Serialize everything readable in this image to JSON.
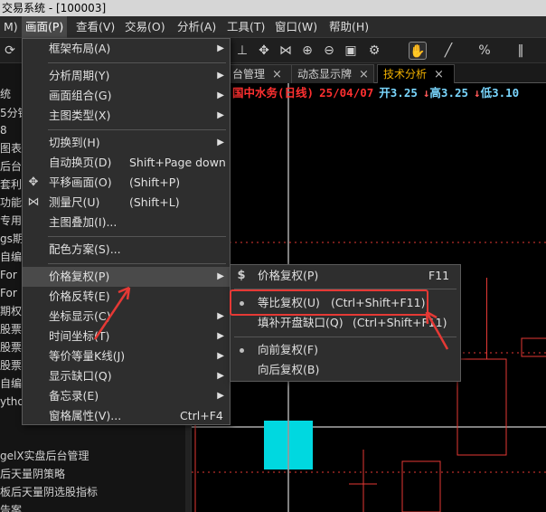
{
  "window": {
    "title": "交易系统 - [100003]"
  },
  "menubar": {
    "items": [
      {
        "label": "M)"
      },
      {
        "label": "画面(P)"
      },
      {
        "label": "查看(V)"
      },
      {
        "label": "交易(O)"
      },
      {
        "label": "分析(A)"
      },
      {
        "label": "工具(T)"
      },
      {
        "label": "窗口(W)"
      },
      {
        "label": "帮助(H)"
      }
    ]
  },
  "tabs": [
    {
      "label": "台管理"
    },
    {
      "label": "动态显示牌"
    },
    {
      "label": "技术分析"
    }
  ],
  "chart_header": {
    "name": "国中水务(日线)",
    "date": "25/04/07",
    "open": "开3.25",
    "high": "高3.25",
    "low": "低3.10"
  },
  "left_panel": {
    "items": [
      "统",
      "5分钟",
      "8",
      "图表",
      "后台",
      "套利",
      "功能",
      "专用",
      "gs期",
      "自编",
      " For",
      " For",
      "期权",
      "股票",
      " 股票",
      " 股票",
      "自编",
      "ytho",
      "",
      "",
      "gelX实盘后台管理",
      "后天量阴策略",
      " 板后天量阴选股指标",
      "告案"
    ]
  },
  "menu": {
    "items": [
      {
        "label": "框架布局(A)",
        "shortcut": "",
        "arrow": "▶"
      },
      {
        "label": "分析周期(Y)",
        "shortcut": "",
        "arrow": "▶"
      },
      {
        "label": "画面组合(G)",
        "shortcut": "",
        "arrow": "▶"
      },
      {
        "label": "主图类型(X)",
        "shortcut": "",
        "arrow": "▶"
      },
      {
        "label": "切换到(H)",
        "shortcut": "",
        "arrow": "▶"
      },
      {
        "label": "自动换页(D)",
        "shortcut": "Shift+Page down",
        "arrow": ""
      },
      {
        "label": "平移画面(O)",
        "shortcut": "(Shift+P)",
        "arrow": ""
      },
      {
        "label": "测量尺(U)",
        "shortcut": "(Shift+L)",
        "arrow": ""
      },
      {
        "label": "主图叠加(I)...",
        "shortcut": "",
        "arrow": ""
      },
      {
        "label": "配色方案(S)...",
        "shortcut": "",
        "arrow": ""
      },
      {
        "label": "价格复权(P)",
        "shortcut": "",
        "arrow": "▶"
      },
      {
        "label": "价格反转(E)",
        "shortcut": "",
        "arrow": ""
      },
      {
        "label": "坐标显示(C)",
        "shortcut": "",
        "arrow": "▶"
      },
      {
        "label": "时间坐标(T)",
        "shortcut": "",
        "arrow": "▶"
      },
      {
        "label": "等价等量K线(J)",
        "shortcut": "",
        "arrow": "▶"
      },
      {
        "label": "显示缺口(Q)",
        "shortcut": "",
        "arrow": "▶"
      },
      {
        "label": "备忘录(E)",
        "shortcut": "",
        "arrow": "▶"
      },
      {
        "label": "窗格属性(V)...",
        "shortcut": "Ctrl+F4",
        "arrow": ""
      }
    ]
  },
  "submenu": {
    "items": [
      {
        "label": "价格复权(P)",
        "shortcut": "F11"
      },
      {
        "label": "等比复权(U)",
        "shortcut": "(Ctrl+Shift+F11)"
      },
      {
        "label": "填补开盘缺口(Q)",
        "shortcut": "(Ctrl+Shift+F11)"
      },
      {
        "label": "向前复权(F)",
        "shortcut": ""
      },
      {
        "label": "向后复权(B)",
        "shortcut": ""
      }
    ]
  },
  "colors": {
    "up_candle": "#e53935",
    "down_candle": "#00d8e0",
    "annotation": "#e53935"
  }
}
